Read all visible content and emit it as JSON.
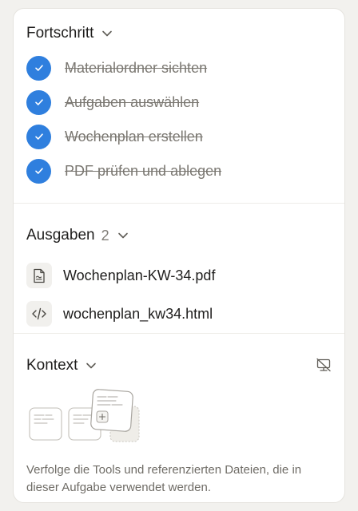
{
  "progress": {
    "title": "Fortschritt",
    "tasks": [
      {
        "label": "Materialordner sichten",
        "done": true
      },
      {
        "label": "Aufgaben auswählen",
        "done": true
      },
      {
        "label": "Wochenplan erstellen",
        "done": true
      },
      {
        "label": "PDF prüfen und ablegen",
        "done": true
      }
    ]
  },
  "outputs": {
    "title": "Ausgaben",
    "count": "2",
    "files": [
      {
        "name": "Wochenplan-KW-34.pdf",
        "icon": "document-icon"
      },
      {
        "name": "wochenplan_kw34.html",
        "icon": "code-icon"
      }
    ]
  },
  "context": {
    "title": "Kontext",
    "toggle_icon": "monitor-off-icon",
    "description": "Verfolge die Tools und referenzierten Dateien, die in dieser Aufgabe verwendet werden."
  },
  "colors": {
    "accent": "#2f7fde",
    "background": "#f2f1ee",
    "panel": "#ffffff"
  }
}
